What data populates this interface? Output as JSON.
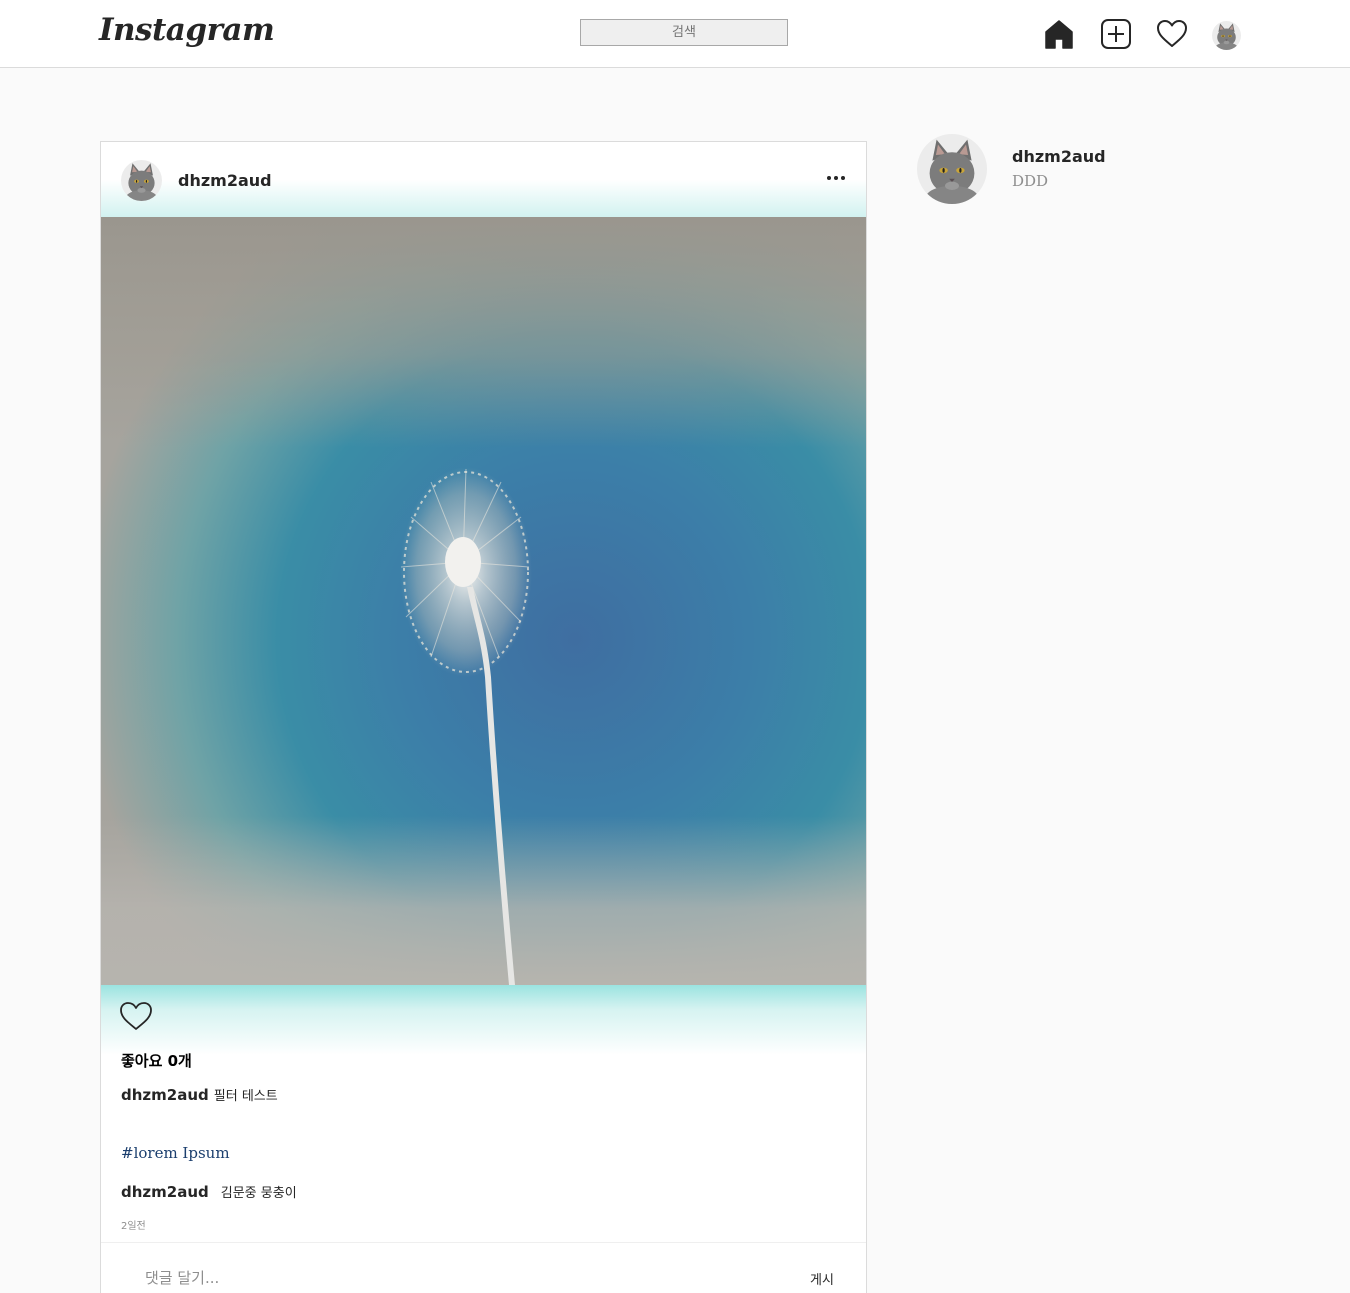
{
  "nav": {
    "logo": "Instagram",
    "search_placeholder": "검색",
    "icons": [
      "home-icon",
      "add-post-icon",
      "heart-icon",
      "profile-avatar"
    ]
  },
  "post": {
    "username": "dhzm2aud",
    "likes_label": "좋아요 0개",
    "caption_user": "dhzm2aud",
    "caption_text": "필터 테스트",
    "hashtag": "#lorem Ipsum",
    "comment_user": "dhzm2aud",
    "comment_text": "김문중 뭉충이",
    "time": "2일전",
    "comment_placeholder": "댓글 달기...",
    "post_button": "게시"
  },
  "sidebar": {
    "username": "dhzm2aud",
    "name": "DDD"
  },
  "colors": {
    "accent_teal": "#9be3e0",
    "hashtag": "#1c3f6e",
    "border": "#dbdbdb"
  }
}
